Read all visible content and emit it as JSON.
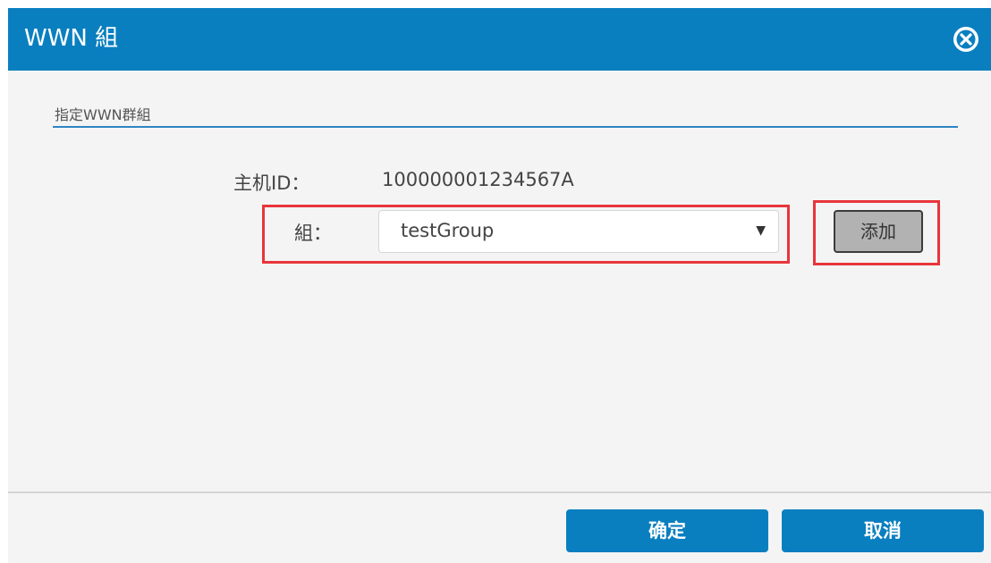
{
  "dialog": {
    "title": "WWN 組",
    "close_icon": "close-circle-icon",
    "accent_color": "#0a7fc0"
  },
  "section": {
    "label": "指定WWN群組"
  },
  "host": {
    "label": "主机ID：",
    "value": "100000001234567A"
  },
  "group": {
    "label": "組：",
    "selected": "testGroup",
    "arrow_icon": "dropdown-arrow-icon"
  },
  "add_button": {
    "label": "添加"
  },
  "footer": {
    "ok_label": "确定",
    "cancel_label": "取消"
  },
  "highlight_color": "#e8353b"
}
